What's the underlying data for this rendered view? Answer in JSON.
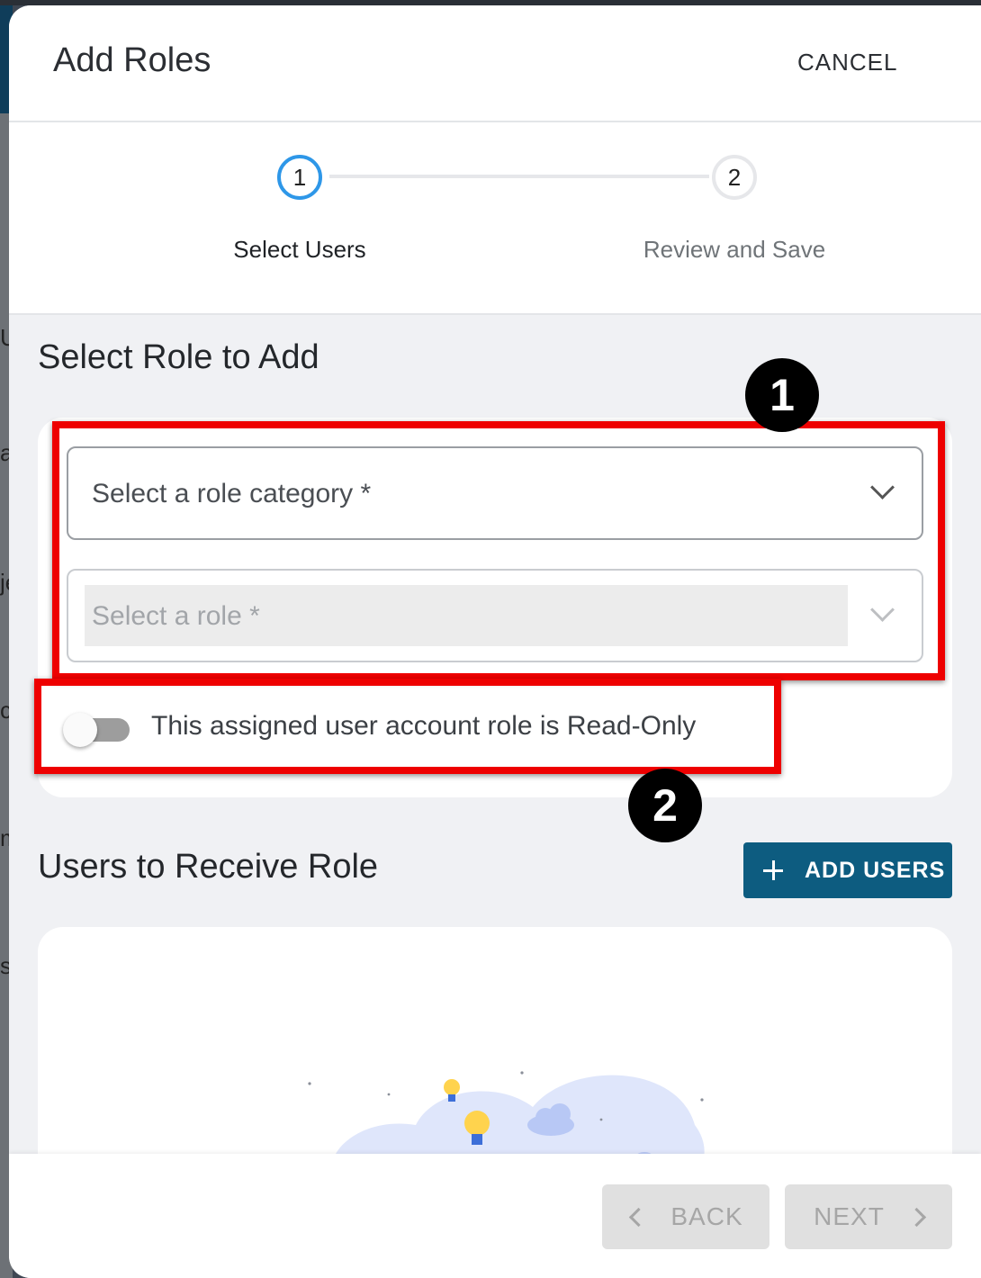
{
  "background": {
    "letters": [
      "U",
      "a",
      "je",
      "ca",
      "m",
      "st"
    ]
  },
  "dialog": {
    "title": "Add Roles",
    "cancel_label": "CANCEL"
  },
  "stepper": {
    "steps": [
      {
        "number": "1",
        "label": "Select Users",
        "state": "active"
      },
      {
        "number": "2",
        "label": "Review and Save",
        "state": "inactive"
      }
    ]
  },
  "role_section": {
    "title": "Select Role to Add",
    "category_select": {
      "placeholder": "Select a role category *",
      "icon": "chevron-down-icon",
      "enabled": true
    },
    "role_select": {
      "placeholder": "Select a role *",
      "icon": "chevron-down-icon",
      "enabled": false
    },
    "read_only_toggle": {
      "label": "This assigned user account role is Read-Only",
      "checked": false
    }
  },
  "users_section": {
    "title": "Users to Receive Role",
    "add_users_label": "ADD USERS",
    "add_users_icon": "plus-icon"
  },
  "annotations": {
    "badge_1": "1",
    "badge_2": "2",
    "highlight_color": "#ee0000"
  },
  "footer": {
    "back_label": "BACK",
    "next_label": "NEXT"
  },
  "colors": {
    "accent_blue": "#2e97e8",
    "button_primary": "#0d5c80",
    "content_bg": "#f0f1f4"
  }
}
